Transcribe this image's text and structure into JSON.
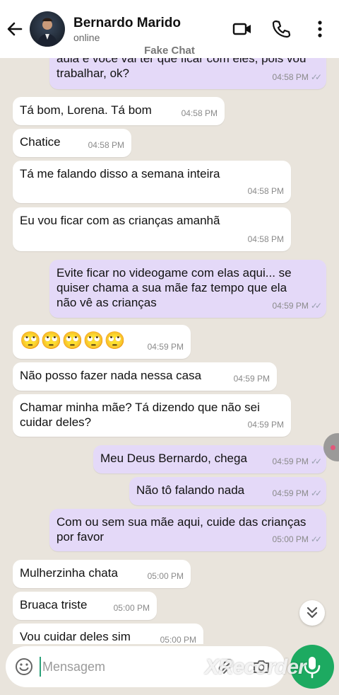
{
  "header": {
    "contact_name": "Bernardo Marido",
    "status": "online",
    "overlay_label": "Fake Chat"
  },
  "messages": [
    {
      "dir": "out",
      "text": "aula e você vai ter que ficar com eles, pois vou\ntrabalhar, ok?",
      "time": "04:58 PM",
      "read": true
    },
    {
      "dir": "in",
      "text": "Tá bom, Lorena. Tá bom",
      "time": "04:58 PM"
    },
    {
      "dir": "in",
      "text": "Chatice",
      "time": "04:58 PM"
    },
    {
      "dir": "in",
      "text": "Tá me falando disso a semana inteira",
      "time": "04:58 PM"
    },
    {
      "dir": "in",
      "text": "Eu vou ficar com as crianças amanhã",
      "time": "04:58 PM"
    },
    {
      "dir": "out",
      "text": "Evite ficar no videogame com elas aqui... se\nquiser chama a sua mãe faz tempo que ela\nnão vê as crianças",
      "time": "04:59 PM",
      "read": true
    },
    {
      "dir": "in",
      "text": "🙄🙄🙄🙄🙄",
      "time": "04:59 PM"
    },
    {
      "dir": "in",
      "text": "Não posso fazer nada nessa casa",
      "time": "04:59 PM"
    },
    {
      "dir": "in",
      "text": "Chamar minha mãe? Tá dizendo que não sei\ncuidar deles?",
      "time": "04:59 PM"
    },
    {
      "dir": "out",
      "text": "Meu Deus Bernardo, chega",
      "time": "04:59 PM",
      "read": true
    },
    {
      "dir": "out",
      "text": "Não tô falando nada",
      "time": "04:59 PM",
      "read": true
    },
    {
      "dir": "out",
      "text": "Com ou sem sua mãe aqui, cuide das crianças\npor favor",
      "time": "05:00 PM",
      "read": true
    },
    {
      "dir": "in",
      "text": "Mulherzinha chata",
      "time": "05:00 PM"
    },
    {
      "dir": "in",
      "text": "Bruaca triste",
      "time": "05:00 PM"
    },
    {
      "dir": "in",
      "text": "Vou cuidar deles sim",
      "time": "05:00 PM"
    }
  ],
  "composer": {
    "placeholder": "Mensagem",
    "value": ""
  },
  "watermark": "XRecorder",
  "colors": {
    "incoming_bubble": "#ffffff",
    "outgoing_bubble": "#e4d9f8",
    "chat_background": "#e9e4dc",
    "mic_button": "#1daa61"
  },
  "icons": {
    "back": "arrow-left-icon",
    "video": "video-camera-icon",
    "call": "phone-icon",
    "menu": "more-vertical-icon",
    "emoji": "emoji-icon",
    "attach": "paperclip-icon",
    "camera": "camera-icon",
    "mic": "microphone-icon",
    "scroll": "chevron-double-down-icon"
  }
}
